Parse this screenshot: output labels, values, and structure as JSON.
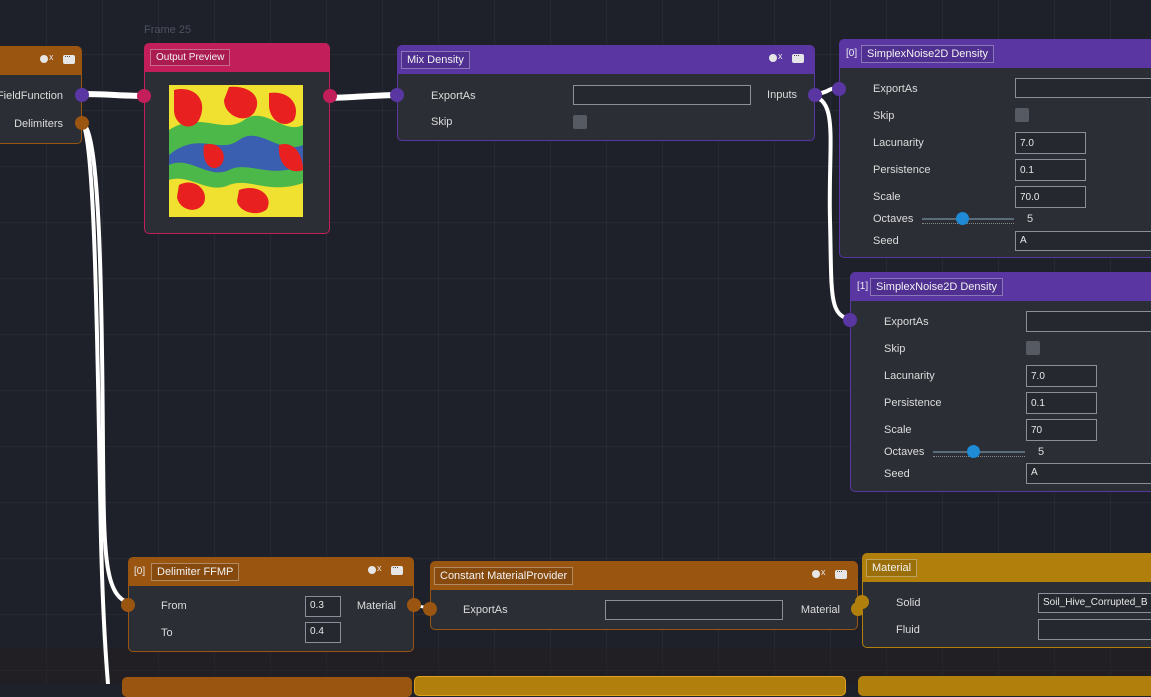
{
  "frame_label": "Frame 25",
  "colors": {
    "orange": "#9a5511",
    "purple": "#5a36a3",
    "crimson": "#c21f5a",
    "gold": "#b07f0c",
    "wire": "#ffffff",
    "slider": "#1f8ad6"
  },
  "left_node": {
    "port1": "FieldFunction",
    "port2": "Delimiters"
  },
  "output_preview": {
    "title": "Output Preview"
  },
  "mix_density": {
    "title": "Mix Density",
    "exportas_label": "ExportAs",
    "exportas_value": "",
    "skip_label": "Skip",
    "out_label": "Inputs"
  },
  "noise0": {
    "index": "[0]",
    "title": "SimplexNoise2D Density",
    "exportas_label": "ExportAs",
    "exportas_value": "",
    "skip_label": "Skip",
    "lacunarity_label": "Lacunarity",
    "lacunarity": "7.0",
    "persistence_label": "Persistence",
    "persistence": "0.1",
    "scale_label": "Scale",
    "scale": "70.0",
    "octaves_label": "Octaves",
    "octaves": "5",
    "seed_label": "Seed",
    "seed": "A"
  },
  "noise1": {
    "index": "[1]",
    "title": "SimplexNoise2D Density",
    "exportas_label": "ExportAs",
    "exportas_value": "",
    "skip_label": "Skip",
    "lacunarity_label": "Lacunarity",
    "lacunarity": "7.0",
    "persistence_label": "Persistence",
    "persistence": "0.1",
    "scale_label": "Scale",
    "scale": "70",
    "octaves_label": "Octaves",
    "octaves": "5",
    "seed_label": "Seed",
    "seed": "A"
  },
  "delimiter": {
    "index": "[0]",
    "title": "Delimiter FFMP",
    "from_label": "From",
    "from": "0.3",
    "to_label": "To",
    "to": "0.4",
    "out_label": "Material"
  },
  "constant_material": {
    "title": "Constant MaterialProvider",
    "exportas_label": "ExportAs",
    "exportas_value": "",
    "out_label": "Material"
  },
  "material": {
    "title": "Material",
    "solid_label": "Solid",
    "solid": "Soil_Hive_Corrupted_B",
    "fluid_label": "Fluid",
    "fluid": ""
  }
}
